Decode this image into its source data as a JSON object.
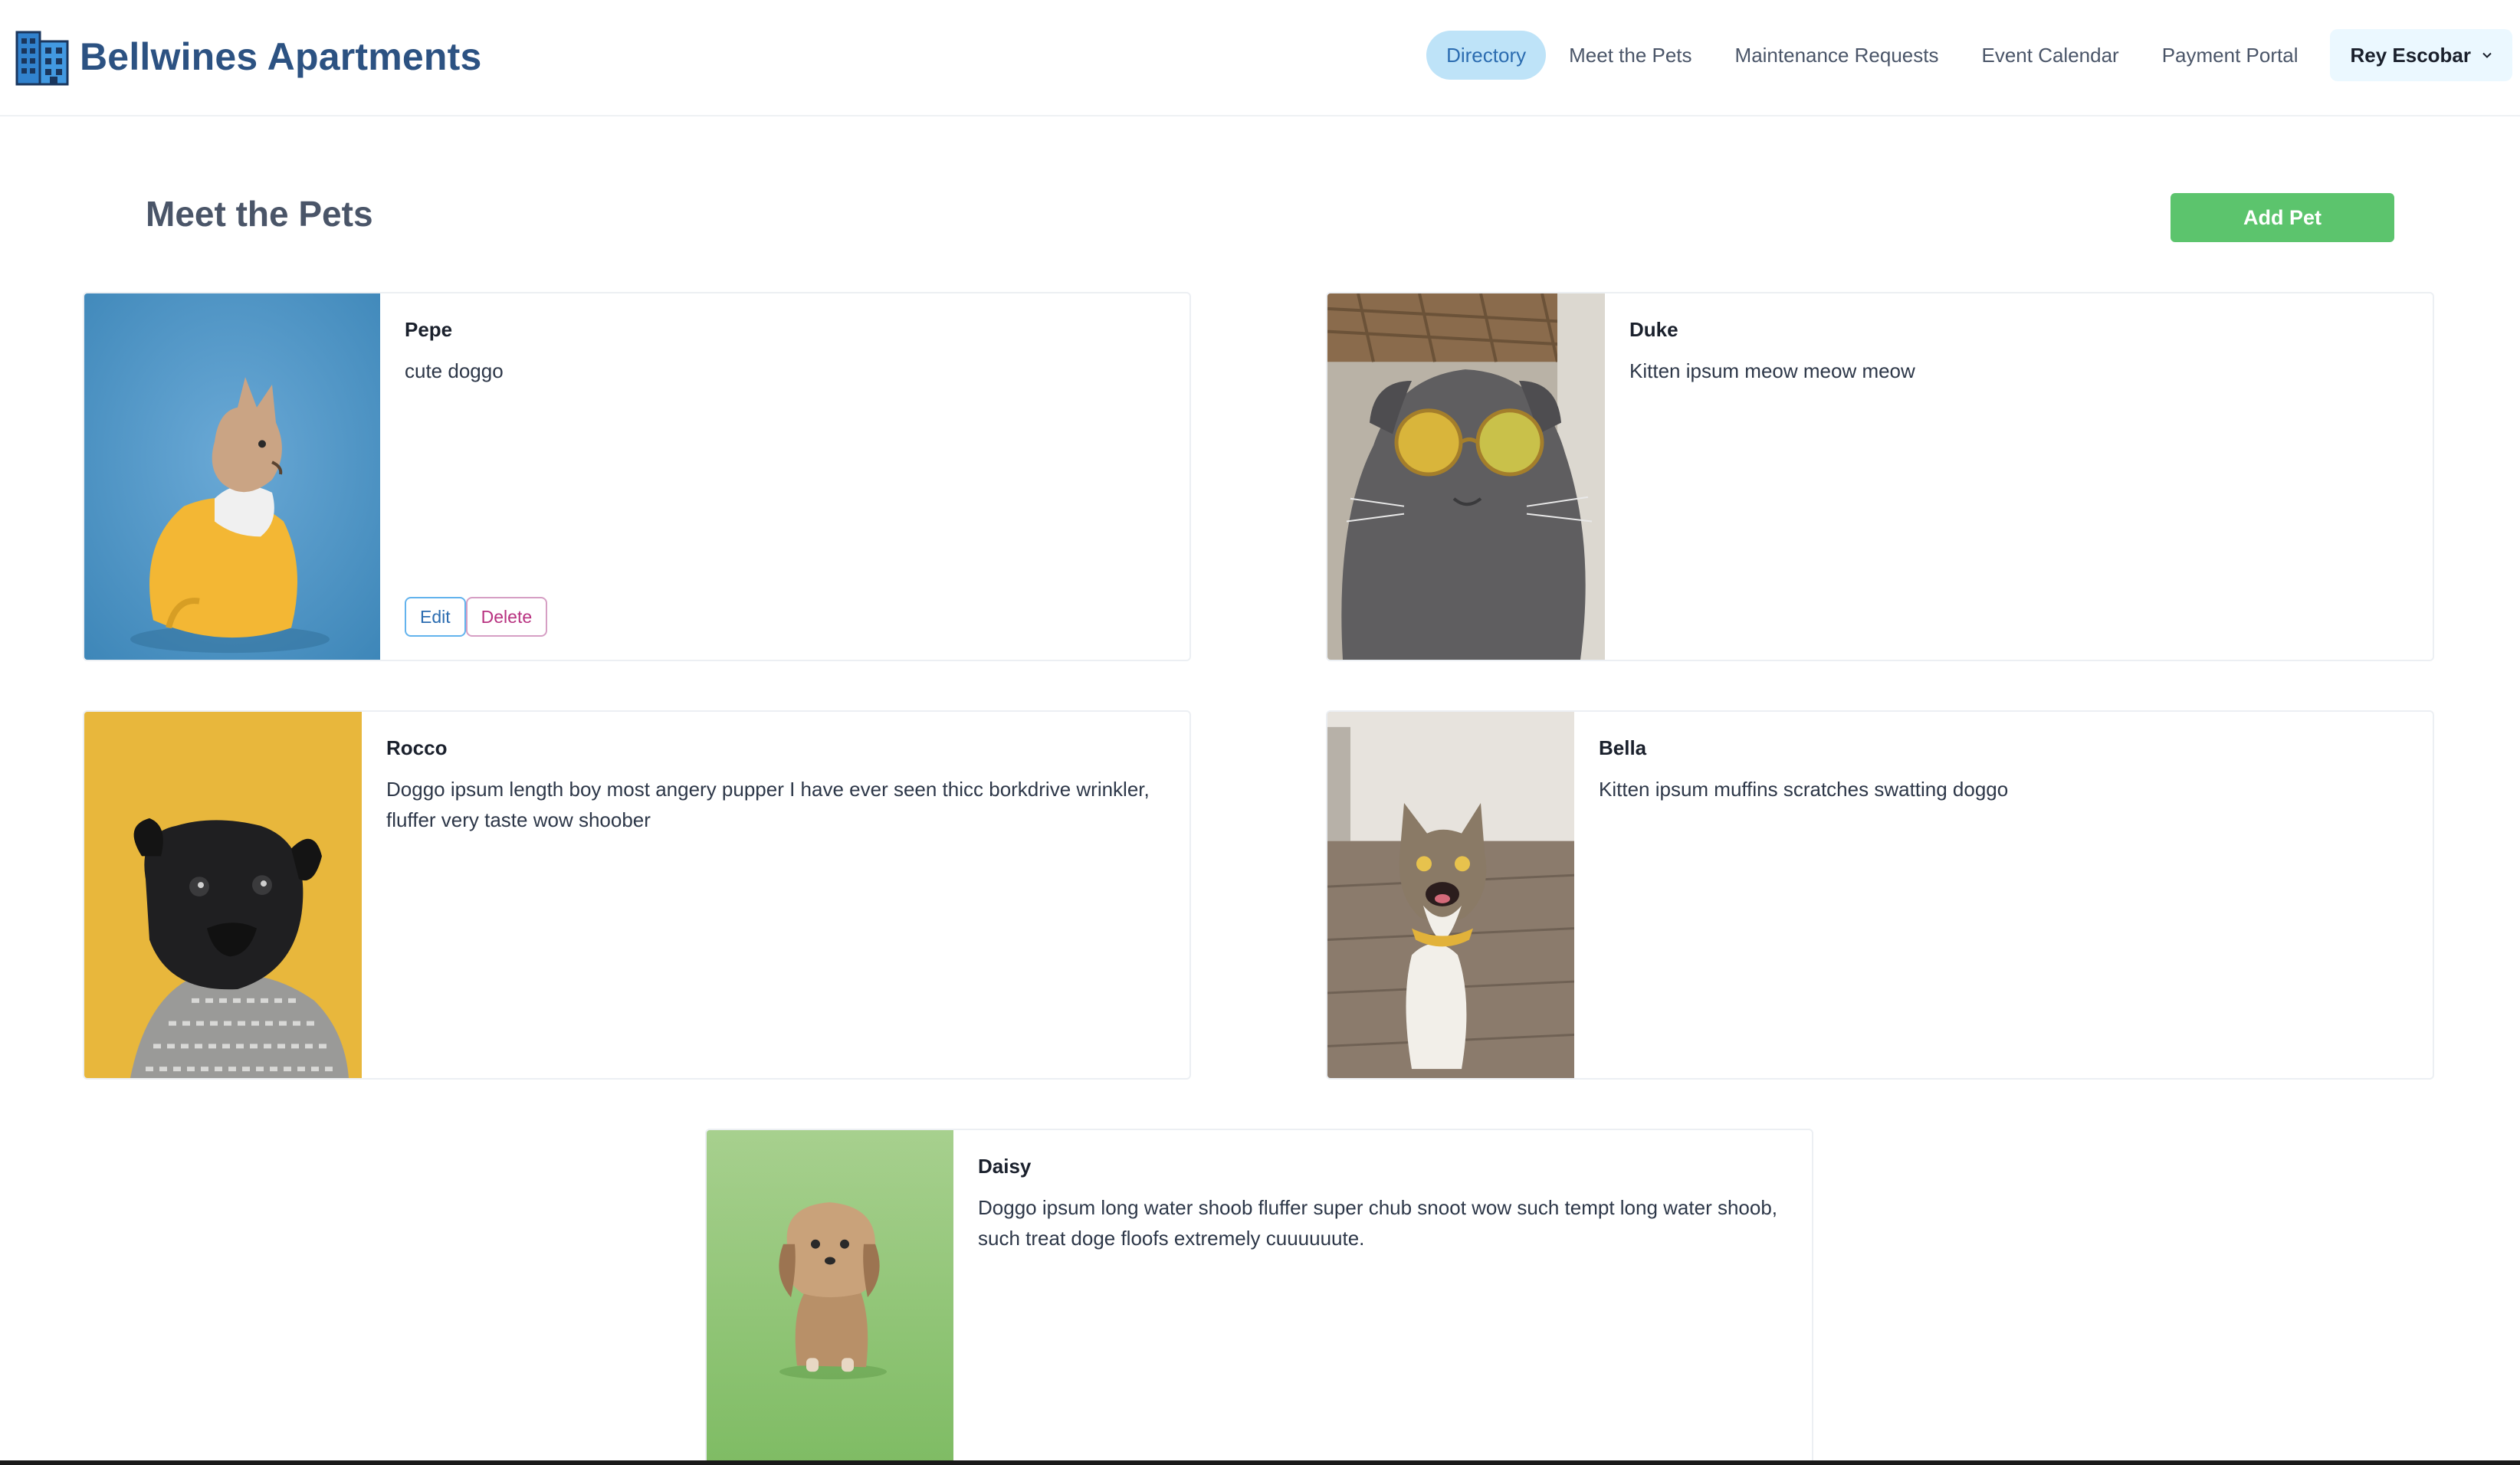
{
  "app": {
    "name": "Bellwines Apartments",
    "logo_icon": "building-icon",
    "brand_color": "#2c5282"
  },
  "nav": {
    "items": [
      {
        "label": "Directory",
        "active": true
      },
      {
        "label": "Meet the Pets",
        "active": false
      },
      {
        "label": "Maintenance Requests",
        "active": false
      },
      {
        "label": "Event Calendar",
        "active": false
      },
      {
        "label": "Payment Portal",
        "active": false
      }
    ],
    "user": {
      "name": "Rey Escobar",
      "icon": "chevron-down-icon"
    }
  },
  "page": {
    "title": "Meet the Pets",
    "add_button": "Add Pet",
    "accent": "#5cc46d"
  },
  "pets": [
    {
      "name": "Pepe",
      "description": "cute doggo",
      "photo": "french-bulldog-photo",
      "actions": {
        "edit": "Edit",
        "delete": "Delete"
      }
    },
    {
      "name": "Duke",
      "description": "Kitten ipsum meow meow meow",
      "photo": "cat-with-sunglasses-photo"
    },
    {
      "name": "Rocco",
      "description": "Doggo ipsum length boy most angery pupper I have ever seen thicc borkdrive wrinkler, fluffer very taste wow shoober",
      "photo": "pug-in-sweater-photo"
    },
    {
      "name": "Bella",
      "description": "Kitten ipsum muffins scratches swatting doggo",
      "photo": "tabby-cat-photo"
    },
    {
      "name": "Daisy",
      "description": "Doggo ipsum long water shoob fluffer super chub snoot wow such tempt long water shoob, such treat doge floofs extremely cuuuuuute.",
      "photo": "shih-tzu-photo"
    }
  ]
}
